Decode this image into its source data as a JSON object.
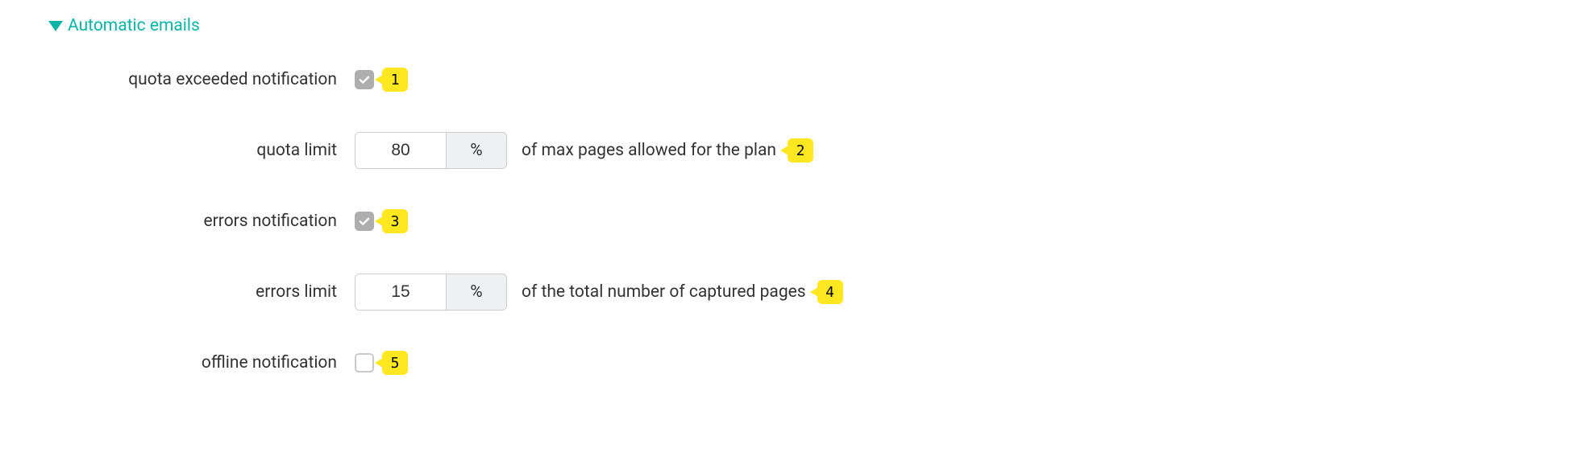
{
  "section": {
    "title": "Automatic emails"
  },
  "rows": {
    "quota_exceeded": {
      "label": "quota exceeded notification",
      "checked": true,
      "callout": "1"
    },
    "quota_limit": {
      "label": "quota limit",
      "value": "80",
      "unit": "%",
      "desc": "of max pages allowed for the plan",
      "callout": "2"
    },
    "errors_notification": {
      "label": "errors notification",
      "checked": true,
      "callout": "3"
    },
    "errors_limit": {
      "label": "errors limit",
      "value": "15",
      "unit": "%",
      "desc": "of the total number of captured pages",
      "callout": "4"
    },
    "offline_notification": {
      "label": "offline notification",
      "checked": false,
      "callout": "5"
    }
  }
}
